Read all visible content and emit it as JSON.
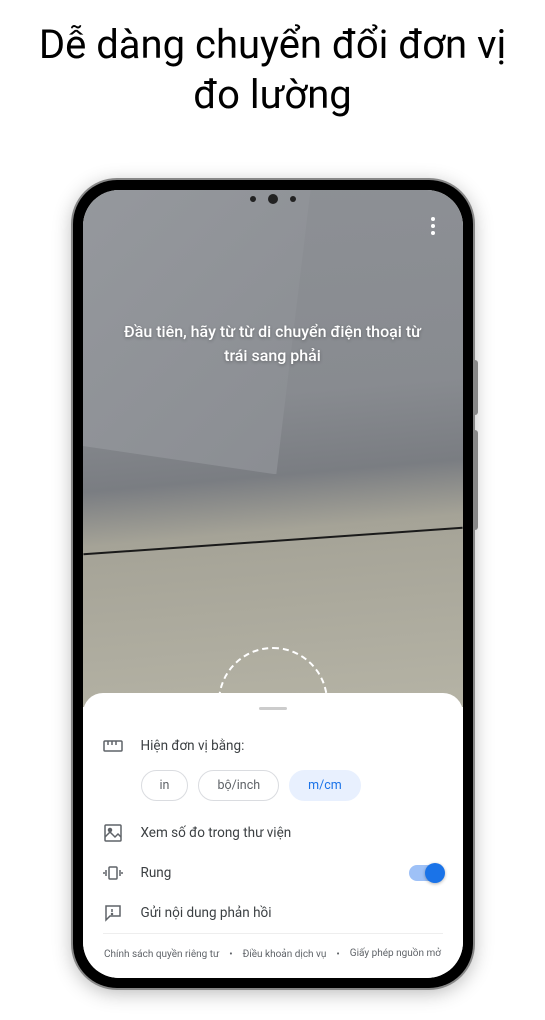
{
  "headline": "Dễ dàng chuyển đổi đơn vị đo lường",
  "instruction": "Đầu tiên, hãy từ từ di chuyển điện thoại từ trái sang phải",
  "sheet": {
    "units_label": "Hiện đơn vị bằng:",
    "unit_options": [
      "in",
      "bộ/inch",
      "m/cm"
    ],
    "selected_unit_index": 2,
    "gallery_label": "Xem số đo trong thư viện",
    "vibrate_label": "Rung",
    "vibrate_on": true,
    "feedback_label": "Gửi nội dung phản hồi"
  },
  "footer": {
    "privacy": "Chính sách quyền riêng tư",
    "terms": "Điều khoản dịch vụ",
    "license": "Giấy phép nguồn mở"
  }
}
